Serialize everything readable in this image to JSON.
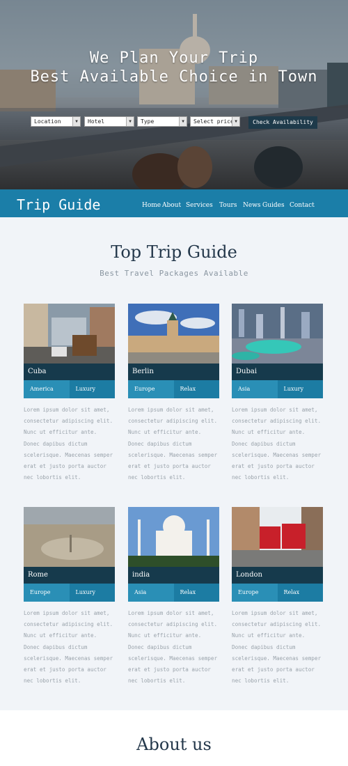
{
  "hero": {
    "title_line1": "We Plan Your Trip",
    "title_line2": "Best Available Choice in Town",
    "selects": [
      {
        "label": "Location"
      },
      {
        "label": "Hotel"
      },
      {
        "label": "Type"
      },
      {
        "label": "Select price"
      }
    ],
    "check_button": "Check Availability"
  },
  "nav": {
    "brand": "Trip Guide",
    "items": [
      "Home",
      "About",
      "Services",
      "Tours",
      "News",
      "Guides",
      "Contact"
    ]
  },
  "section": {
    "title": "Top Trip Guide",
    "subtitle": "Best Travel Packages Available"
  },
  "cards": [
    {
      "name": "Cuba",
      "tag1": "America",
      "tag2": "Luxury"
    },
    {
      "name": "Berlin",
      "tag1": "Europe",
      "tag2": "Relax"
    },
    {
      "name": "Dubai",
      "tag1": "Asia",
      "tag2": "Luxury"
    },
    {
      "name": "Rome",
      "tag1": "Europe",
      "tag2": "Luxury"
    },
    {
      "name": "india",
      "tag1": "Asia",
      "tag2": "Relax"
    },
    {
      "name": "London",
      "tag1": "Europe",
      "tag2": "Relax"
    }
  ],
  "card_desc": "Lorem ipsum dolor sit amet, consectetur adipiscing elit. Nunc ut efficitur ante. Donec dapibus dictum scelerisque. Maecenas semper erat et justo porta auctor nec lobortis elit.",
  "about": {
    "title": "About us"
  },
  "colors": {
    "nav": "#1b7ea8",
    "card_title": "#163a4c",
    "tag_light": "#2a8fb6",
    "tag_dark": "#1c7ca3"
  }
}
